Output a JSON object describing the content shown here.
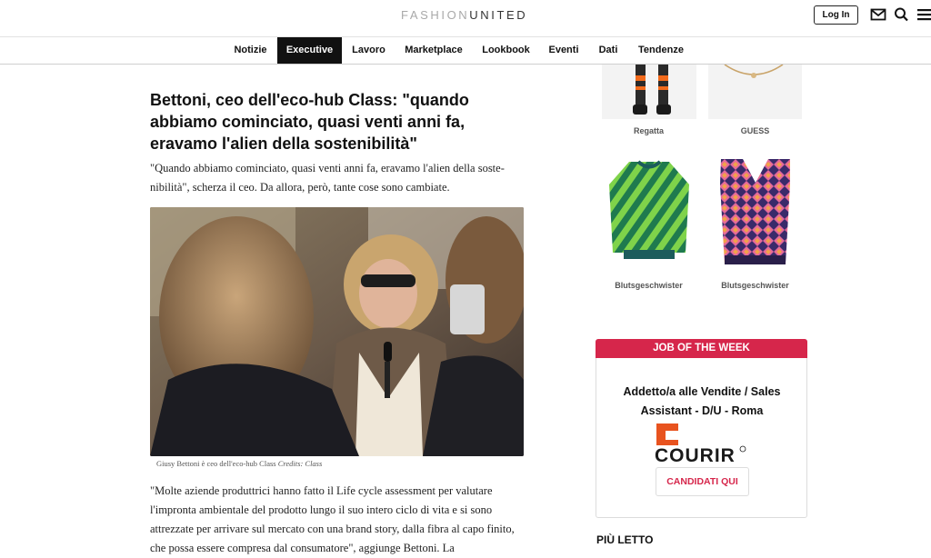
{
  "header": {
    "logo_light": "FASHION",
    "logo_bold": "UNITED",
    "login_label": "Log In",
    "icons": [
      "mail-icon",
      "search-icon",
      "menu-icon"
    ]
  },
  "nav": {
    "items": [
      "Notizie",
      "Executive",
      "Lavoro",
      "Marketplace",
      "Lookbook",
      "Eventi",
      "Dati",
      "Tendenze"
    ],
    "active": "Executive"
  },
  "article": {
    "headline": "Bettoni, ceo dell'eco-hub Class: \"quando abbiamo cominciato, quasi venti anni fa, eravamo l'alien della sostenibilità\"",
    "lead": "\"Quando abbiamo cominciato, quasi venti anni fa, eravamo l'alien della soste-nibilità\", scherza il ceo. Da allora, però, tante cose sono cambiate.",
    "caption_text": "Giusy Bettoni è ceo dell'eco-hub Class ",
    "caption_credits": "Credits: Class",
    "body": "\"Molte aziende produttrici hanno fatto il Life cycle assessment per valutare l'impronta ambientale del prodotto lungo il suo intero ciclo di vita e si sono attrezzate per arrivare sul mercato con una brand story, dalla fibra al capo finito, che possa essere compresa dal consumatore\", aggiunge Bettoni. La"
  },
  "sidebar": {
    "products": [
      {
        "brand": "Regatta"
      },
      {
        "brand": "GUESS"
      },
      {
        "brand": "Blutsgeschwister"
      },
      {
        "brand": "Blutsgeschwister"
      }
    ],
    "job": {
      "header": "JOB OF THE WEEK",
      "title": "Addetto/a alle Vendite / Sales Assistant - D/U - Roma",
      "company_logo": "COURIR",
      "apply_label": "CANDIDATI QUI"
    },
    "most_read": "PIÙ LETTO"
  },
  "colors": {
    "accent": "#d6264b",
    "courir_orange": "#e8531f",
    "nav_active_bg": "#111111"
  }
}
